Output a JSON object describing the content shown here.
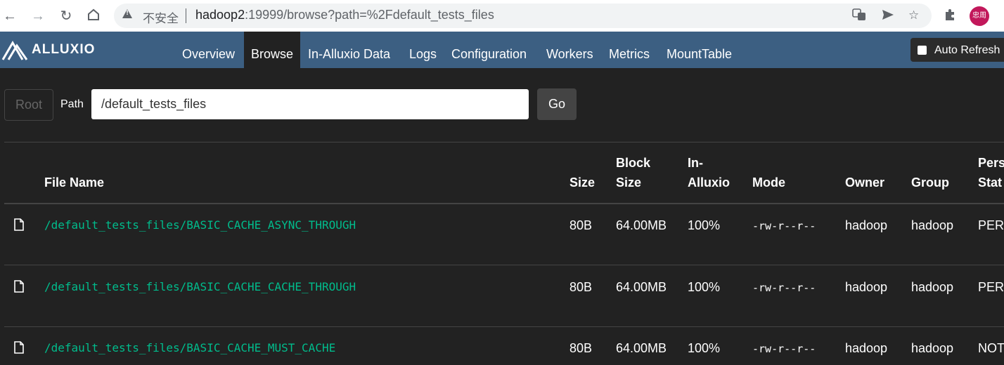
{
  "browser": {
    "security_label": "不安全",
    "url_host": "hadoop2",
    "url_rest": ":19999/browse?path=%2Fdefault_tests_files",
    "profile_label": "忠周"
  },
  "app": {
    "brand": "ALLUXIO",
    "nav": [
      {
        "label": "Overview",
        "active": false
      },
      {
        "label": "Browse",
        "active": true
      },
      {
        "label": "In-Alluxio Data",
        "active": false
      },
      {
        "label": "Logs",
        "active": false
      },
      {
        "label": "Configuration",
        "active": false
      },
      {
        "label": "Workers",
        "active": false
      },
      {
        "label": "Metrics",
        "active": false
      },
      {
        "label": "MountTable",
        "active": false
      }
    ],
    "auto_refresh_label": "Auto Refresh"
  },
  "pathbar": {
    "root_label": "Root",
    "path_label": "Path",
    "path_value": "/default_tests_files",
    "go_label": "Go"
  },
  "table": {
    "headers": {
      "file_name": "File Name",
      "size": "Size",
      "block_size_1": "Block",
      "block_size_2": "Size",
      "in_alluxio_1": "In-",
      "in_alluxio_2": "Alluxio",
      "mode": "Mode",
      "owner": "Owner",
      "group": "Group",
      "persistence_1": "Pers",
      "persistence_2": "Stat"
    },
    "rows": [
      {
        "name": "/default_tests_files/BASIC_CACHE_ASYNC_THROUGH",
        "size": "80B",
        "block_size": "64.00MB",
        "in_alluxio": "100%",
        "mode": "-rw-r--r--",
        "owner": "hadoop",
        "group": "hadoop",
        "persistence": "PERS"
      },
      {
        "name": "/default_tests_files/BASIC_CACHE_CACHE_THROUGH",
        "size": "80B",
        "block_size": "64.00MB",
        "in_alluxio": "100%",
        "mode": "-rw-r--r--",
        "owner": "hadoop",
        "group": "hadoop",
        "persistence": "PERS"
      },
      {
        "name": "/default_tests_files/BASIC_CACHE_MUST_CACHE",
        "size": "80B",
        "block_size": "64.00MB",
        "in_alluxio": "100%",
        "mode": "-rw-r--r--",
        "owner": "hadoop",
        "group": "hadoop",
        "persistence": "NOT"
      }
    ]
  },
  "colors": {
    "navbar": "#3c5f82",
    "background": "#222222",
    "file_link": "#00bc8c"
  }
}
